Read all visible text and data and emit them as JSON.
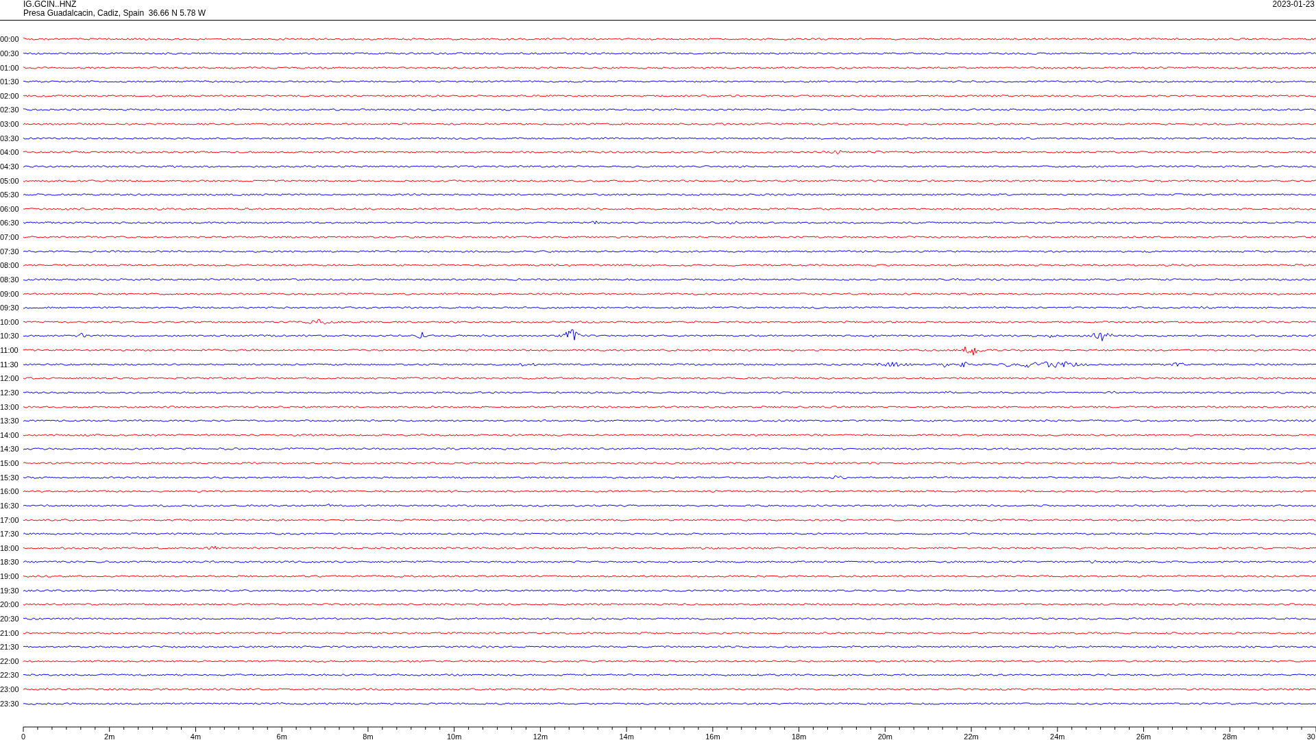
{
  "header": {
    "station": "IG.GCIN..HNZ",
    "location": "Presa Guadalcacin, Cadiz, Spain  36.66 N 5.78 W",
    "date": "2023-01-23"
  },
  "rows": [
    {
      "time": "00:00",
      "color": "#ff0000"
    },
    {
      "time": "00:30",
      "color": "#0000ff"
    },
    {
      "time": "01:00",
      "color": "#ff0000"
    },
    {
      "time": "01:30",
      "color": "#0000ff"
    },
    {
      "time": "02:00",
      "color": "#ff0000"
    },
    {
      "time": "02:30",
      "color": "#0000ff"
    },
    {
      "time": "03:00",
      "color": "#ff0000"
    },
    {
      "time": "03:30",
      "color": "#0000ff"
    },
    {
      "time": "04:00",
      "color": "#ff0000"
    },
    {
      "time": "04:30",
      "color": "#0000ff"
    },
    {
      "time": "05:00",
      "color": "#ff0000"
    },
    {
      "time": "05:30",
      "color": "#0000ff"
    },
    {
      "time": "06:00",
      "color": "#ff0000"
    },
    {
      "time": "06:30",
      "color": "#0000ff"
    },
    {
      "time": "07:00",
      "color": "#ff0000"
    },
    {
      "time": "07:30",
      "color": "#0000ff"
    },
    {
      "time": "08:00",
      "color": "#ff0000"
    },
    {
      "time": "08:30",
      "color": "#0000ff"
    },
    {
      "time": "09:00",
      "color": "#ff0000"
    },
    {
      "time": "09:30",
      "color": "#0000ff"
    },
    {
      "time": "10:00",
      "color": "#ff0000"
    },
    {
      "time": "10:30",
      "color": "#0000ff"
    },
    {
      "time": "11:00",
      "color": "#ff0000"
    },
    {
      "time": "11:30",
      "color": "#0000ff"
    },
    {
      "time": "12:00",
      "color": "#ff0000"
    },
    {
      "time": "12:30",
      "color": "#0000ff"
    },
    {
      "time": "13:00",
      "color": "#ff0000"
    },
    {
      "time": "13:30",
      "color": "#0000ff"
    },
    {
      "time": "14:00",
      "color": "#ff0000"
    },
    {
      "time": "14:30",
      "color": "#0000ff"
    },
    {
      "time": "15:00",
      "color": "#ff0000"
    },
    {
      "time": "15:30",
      "color": "#0000ff"
    },
    {
      "time": "16:00",
      "color": "#ff0000"
    },
    {
      "time": "16:30",
      "color": "#0000ff"
    },
    {
      "time": "17:00",
      "color": "#ff0000"
    },
    {
      "time": "17:30",
      "color": "#0000ff"
    },
    {
      "time": "18:00",
      "color": "#ff0000"
    },
    {
      "time": "18:30",
      "color": "#0000ff"
    },
    {
      "time": "19:00",
      "color": "#ff0000"
    },
    {
      "time": "19:30",
      "color": "#0000ff"
    },
    {
      "time": "20:00",
      "color": "#ff0000"
    },
    {
      "time": "20:30",
      "color": "#0000ff"
    },
    {
      "time": "21:00",
      "color": "#ff0000"
    },
    {
      "time": "21:30",
      "color": "#0000ff"
    },
    {
      "time": "22:00",
      "color": "#ff0000"
    },
    {
      "time": "22:30",
      "color": "#0000ff"
    },
    {
      "time": "23:00",
      "color": "#ff0000"
    },
    {
      "time": "23:30",
      "color": "#0000ff"
    }
  ],
  "x_axis": {
    "tick_labels": [
      "0",
      "2m",
      "4m",
      "6m",
      "8m",
      "10m",
      "12m",
      "14m",
      "16m",
      "18m",
      "20m",
      "22m",
      "24m",
      "26m",
      "28m",
      "30"
    ]
  }
}
